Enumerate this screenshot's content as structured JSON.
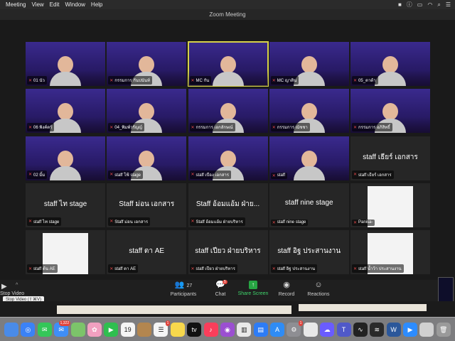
{
  "menubar": {
    "items": [
      "Meeting",
      "View",
      "Edit",
      "Window",
      "Help"
    ]
  },
  "window": {
    "title": "Zoom Meeting"
  },
  "gallery": {
    "tiles": [
      {
        "label": "01 นัว",
        "video": true
      },
      {
        "label": "กรรมการ กันปนันท์",
        "video": true
      },
      {
        "label": "MC กัน",
        "video": true,
        "active": true
      },
      {
        "label": "MC ญาติน",
        "video": true
      },
      {
        "label": "05_ตาต้า",
        "video": true
      },
      {
        "label": "06 พิงค์ตร์",
        "video": true
      },
      {
        "label": "04_พิมพ์วรัญญ์",
        "video": true
      },
      {
        "label": "กรรมการ เอกลักษณ์",
        "video": true
      },
      {
        "label": "กรรมการ ณัชชา",
        "video": true
      },
      {
        "label": "กรรมการ อภิสิทธิ์",
        "video": true
      },
      {
        "label": "02 มิ้ม",
        "video": true
      },
      {
        "label": "staff โฟ้ stage",
        "video": true
      },
      {
        "label": "staff เบือง เอกสาร",
        "video": true
      },
      {
        "label": "staff",
        "video": true
      },
      {
        "label": "staff เธียร์ เอกสาร",
        "name": "staff เธียร์ เอกสาร"
      },
      {
        "label": "staff ไท stage",
        "name": "staff ไท stage"
      },
      {
        "label": "Staff ม่อน เอกสาร",
        "name": "Staff ม่อน เอกสาร"
      },
      {
        "label": "Staff อ้อมแอ้ม ฝ่ายบริหาร",
        "name": "Staff อ้อมแอ้ม ฝ่าย..."
      },
      {
        "label": "staff nine stage",
        "name": "staff nine stage"
      },
      {
        "label": "Panisa-",
        "photo": true
      },
      {
        "label": "staff ต้น AE",
        "photo": true
      },
      {
        "label": "staff ตา AE",
        "name": "staff ตา AE"
      },
      {
        "label": "staff เปียว ฝ่ายบริหาร",
        "name": "staff เปียว ฝ่ายบริหาร"
      },
      {
        "label": "staff อิฐ ประสานงาน",
        "name": "staff อิฐ ประสานงาน"
      },
      {
        "label": "staff น้ำว้า ประสานงาน",
        "photo": true
      }
    ]
  },
  "controls": {
    "stop_video": "Stop Video",
    "stop_video_tooltip": "Stop Video (⇧⌘V)",
    "participants": "Participants",
    "participants_count": "27",
    "chat": "Chat",
    "chat_badge": "5",
    "share": "Share Screen",
    "record": "Record",
    "reactions": "Reactions"
  },
  "dock": {
    "calendar_day": "19",
    "badges": {
      "mail": "1,322",
      "reminders": "1",
      "settings": "1"
    }
  },
  "colors": {
    "active_outline": "#d6d24a",
    "share_green": "#27a543",
    "badge_red": "#e0433b"
  }
}
